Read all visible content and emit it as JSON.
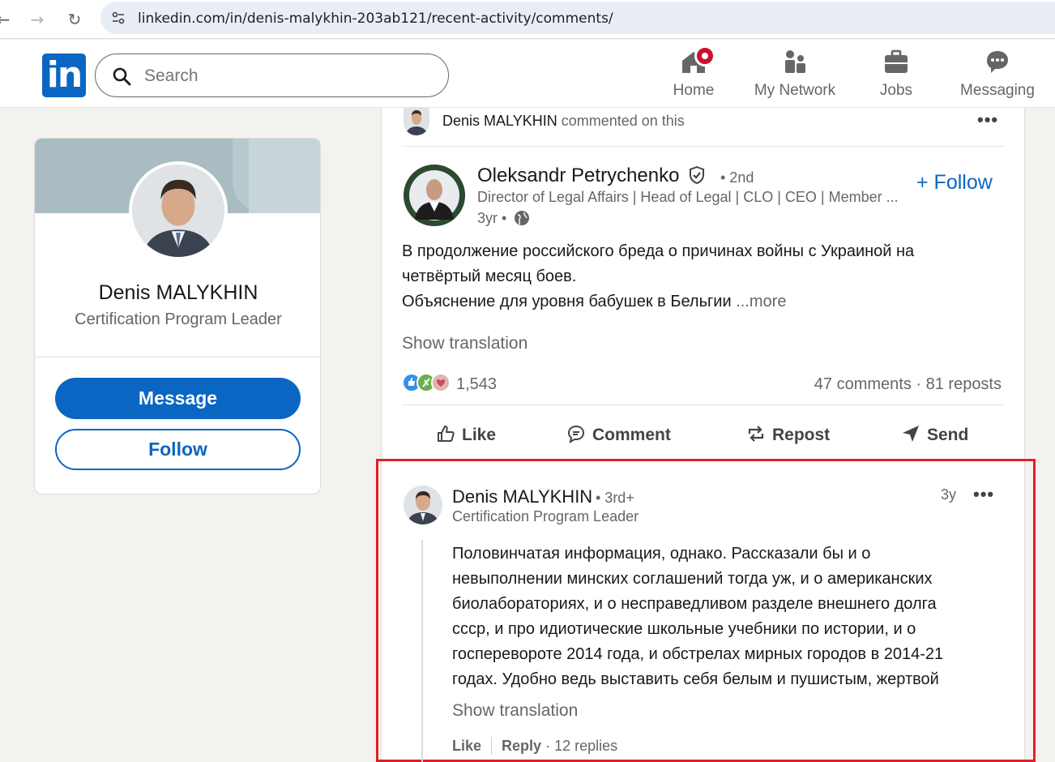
{
  "browser": {
    "url": "linkedin.com/in/denis-malykhin-203ab121/recent-activity/comments/"
  },
  "header": {
    "logo_text": "in",
    "search_placeholder": "Search",
    "nav": [
      {
        "label": "Home",
        "icon": "home-icon"
      },
      {
        "label": "My Network",
        "icon": "network-icon"
      },
      {
        "label": "Jobs",
        "icon": "briefcase-icon"
      },
      {
        "label": "Messaging",
        "icon": "messaging-icon"
      }
    ]
  },
  "profile": {
    "name": "Denis MALYKHIN",
    "headline": "Certification Program Leader",
    "message_label": "Message",
    "follow_label": "Follow"
  },
  "activity": {
    "actor": "Denis MALYKHIN",
    "action_text": " commented on this"
  },
  "post": {
    "author": "Oleksandr Petrychenko",
    "degree": "• 2nd",
    "headline": "Director of Legal Affairs | Head of Legal | CLO | CEO | Member ...",
    "time": "3yr •",
    "follow_label": "+ Follow",
    "text_lines": [
      "В продолжение российского бреда о причинах войны с Украиной на",
      "четвёртый месяц боев.",
      "Объяснение для уровня бабушек в Бельгии "
    ],
    "more_label": "...more",
    "show_translation": "Show translation",
    "reaction_count": "1,543",
    "social_counts": "47 comments · 81 reposts",
    "actions": [
      "Like",
      "Comment",
      "Repost",
      "Send"
    ]
  },
  "comment": {
    "author": "Denis MALYKHIN",
    "degree": "• 3rd+",
    "headline": "Certification Program Leader",
    "time": "3y",
    "text_lines": [
      "Половинчатая информация, однако. Рассказали бы и о",
      "невыполнении минских соглашений тогда уж, и о американских",
      "биолабораториях, и о несправедливом разделе внешнего долга",
      "ссср, и про идиотические школьные учебники по истории, и о",
      "госперевороте 2014 года, и обстрелах мирных городов в 2014-21",
      "годах. Удобно ведь выставить себя белым и пушистым, жертвой"
    ],
    "show_translation": "Show translation",
    "like_label": "Like",
    "reply_label": "Reply",
    "replies": "· 12 replies"
  },
  "colors": {
    "linkedin_blue": "#0a66c2",
    "highlight_red": "#e02128",
    "notification_red": "#cb112d"
  }
}
